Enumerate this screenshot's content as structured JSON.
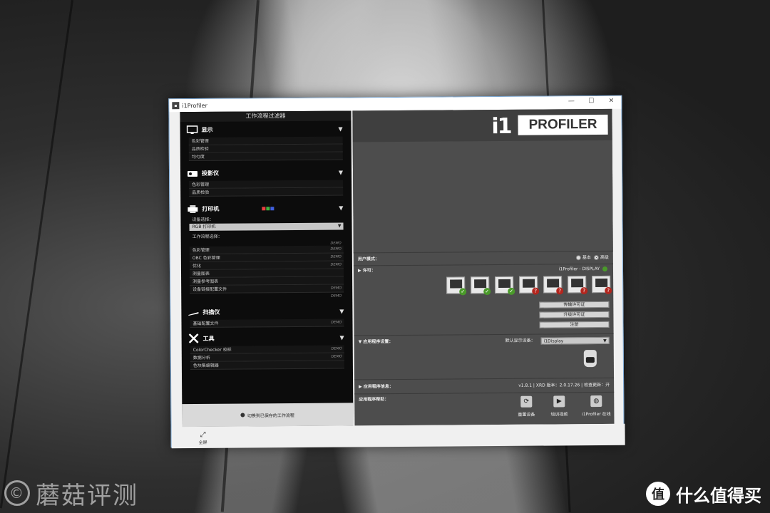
{
  "watermark": {
    "left_text": "蘑菇评测",
    "left_symbol": "©",
    "right_logo": "值",
    "right_text": "什么值得买"
  },
  "window": {
    "title": "i1Profiler",
    "controls": [
      "—",
      "☐",
      "✕"
    ]
  },
  "left_panel": {
    "header": "工作流程过滤器",
    "display": {
      "title": "显示",
      "icon": "monitor-icon",
      "items": [
        "色彩管理",
        "品质检验",
        "均匀度"
      ]
    },
    "projector": {
      "title": "投影仪",
      "icon": "projector-icon",
      "items": [
        "色彩管理",
        "品质检验"
      ]
    },
    "printer": {
      "title": "打印机",
      "icon": "printer-icon",
      "device_label": "设备选择：",
      "device_value": "RGB 打印机",
      "workflow_label": "工作流程选择：",
      "demo": "DEMO",
      "items": [
        {
          "label": "色彩管理",
          "demo": "DEMO"
        },
        {
          "label": "OBC 色彩管理",
          "demo": "DEMO"
        },
        {
          "label": "优化",
          "demo": "DEMO"
        },
        {
          "label": "测量图表",
          "demo": ""
        },
        {
          "label": "测量参考图表",
          "demo": ""
        },
        {
          "label": "设备链接配置文件",
          "demo": "DEMO"
        }
      ],
      "extra_demo": "DEMO",
      "chip_colors": [
        "#e84040",
        "#40b040",
        "#4060e0"
      ]
    },
    "scanner": {
      "title": "扫描仪",
      "icon": "scanner-icon",
      "items": [
        {
          "label": "基础配置文件",
          "demo": "DEMO"
        }
      ]
    },
    "tools": {
      "title": "工具",
      "icon": "tools-icon",
      "items": [
        {
          "label": "ColorChecker 校样",
          "demo": "DEMO"
        },
        {
          "label": "数据分析",
          "demo": "DEMO"
        },
        {
          "label": "色块集编辑器",
          "demo": ""
        }
      ]
    },
    "footer": "切换到已保存的工作流程"
  },
  "right_panel": {
    "logo_i1": "i1",
    "logo_text": "PROFILER",
    "user_mode": {
      "label": "用户模式：",
      "option_basic": "基本",
      "option_advanced": "高级",
      "selected": "高级"
    },
    "license": {
      "label": "许可：",
      "device": "i1Profiler - DISPLAY",
      "icons": [
        {
          "name": "display-license-icon",
          "status": "ok"
        },
        {
          "name": "display-qa-license-icon",
          "status": "ok"
        },
        {
          "name": "projector-license-icon",
          "status": "ok"
        },
        {
          "name": "printer-license-icon",
          "status": "no"
        },
        {
          "name": "cmyk-license-icon",
          "status": "no"
        },
        {
          "name": "scanner-license-icon",
          "status": "no"
        },
        {
          "name": "pen-license-icon",
          "status": "no"
        }
      ],
      "buttons": [
        "传输许可证",
        "升级许可证",
        "注册"
      ]
    },
    "app_settings": {
      "label": "应用程序设置：",
      "default_device_label": "默认显示设备：",
      "default_device_value": "i1Display"
    },
    "app_info": {
      "label": "应用程序信息：",
      "text": "v1.8.1 | XRD 版本：2.0.17.26 | 检查更新：开"
    },
    "app_help": {
      "label": "应用程序帮助：",
      "tools": [
        "重置设备",
        "培训视频",
        "i1Profiler 在线"
      ]
    }
  },
  "bottom": {
    "fullscreen_label": "全屏"
  }
}
